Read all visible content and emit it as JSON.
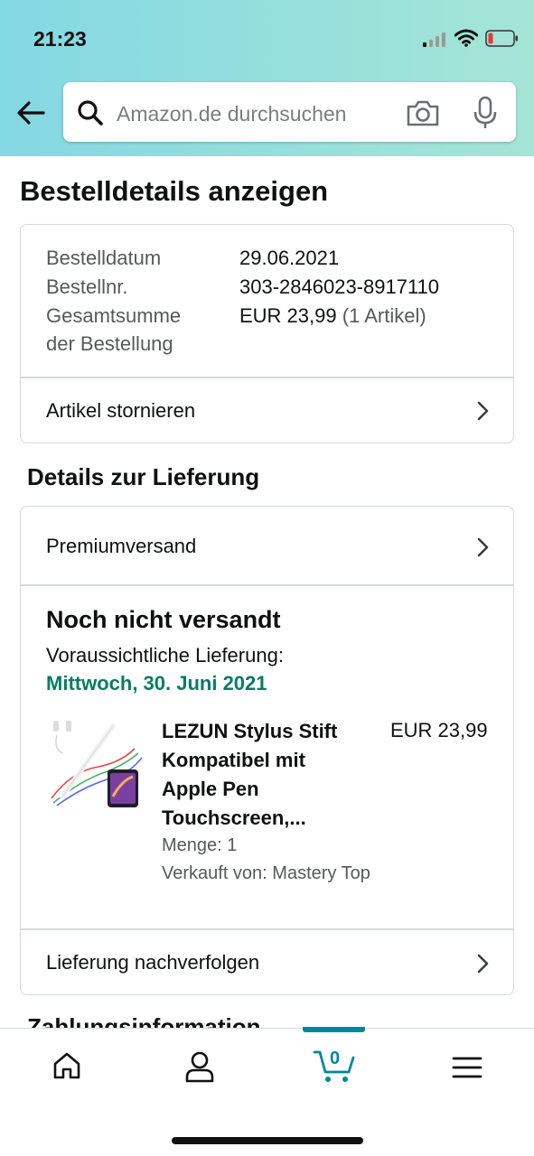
{
  "status_bar": {
    "time": "21:23"
  },
  "search": {
    "placeholder": "Amazon.de durchsuchen"
  },
  "page": {
    "title": "Bestelldetails anzeigen"
  },
  "order_summary": {
    "rows": [
      {
        "label": "Bestelldatum",
        "value": "29.06.2021"
      },
      {
        "label": "Bestellnr.",
        "value": "303-2846023-8917110"
      }
    ],
    "total_label_line1": "Gesamtsumme",
    "total_label_line2": "der Bestellung",
    "total_value": "EUR 23,99",
    "total_count": "(1 Artikel)",
    "cancel_link": "Artikel stornieren"
  },
  "delivery": {
    "section_title": "Details zur Lieferung",
    "shipping_method": "Premiumversand",
    "status": "Noch nicht versandt",
    "expected_label": "Voraussichtliche Lieferung:",
    "expected_date": "Mittwoch, 30. Juni 2021",
    "product": {
      "title_lines": [
        "LEZUN Stylus Stift",
        "Kompatibel mit",
        "Apple Pen",
        "Touchscreen,..."
      ],
      "price": "EUR 23,99",
      "quantity": "Menge: 1",
      "seller": "Verkauft von: Mastery Top"
    },
    "track_link": "Lieferung nachverfolgen"
  },
  "next_section_partial": "Zahlungsinformation",
  "bottom_nav": {
    "items": [
      "home-icon",
      "account-icon",
      "cart-icon",
      "menu-icon"
    ],
    "cart_count": "0",
    "accent_color": "#00889a"
  },
  "colors": {
    "delivery_date": "#067d62"
  }
}
